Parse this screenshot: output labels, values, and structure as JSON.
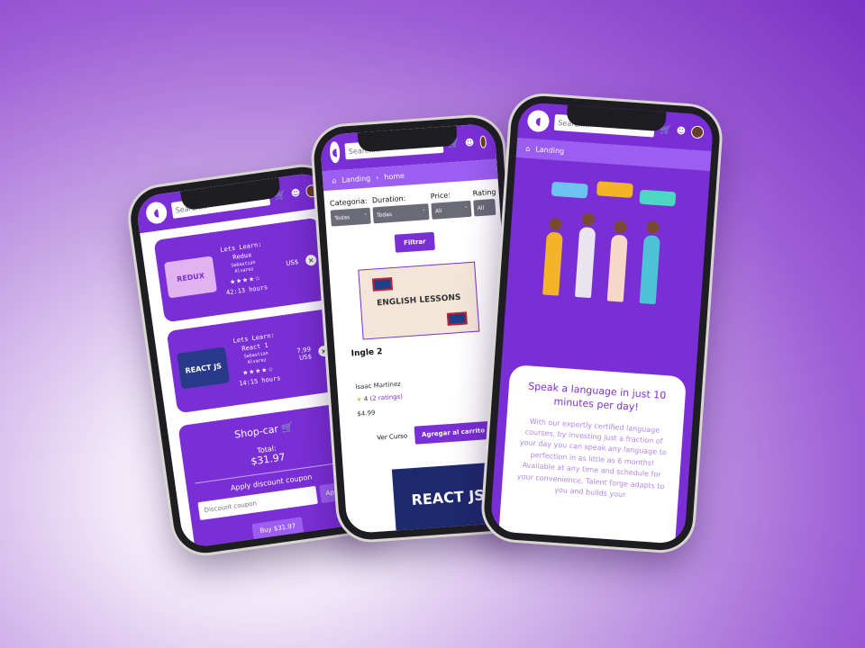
{
  "common": {
    "search_placeholder": "Search...",
    "logo_glyph": "◖",
    "cart_icon": "cart-icon",
    "user_icon": "user-icon"
  },
  "phone1": {
    "courses": [
      {
        "title": "Lets Learn:",
        "subtitle": "Redux",
        "author": "Sebastian Alvarez",
        "hours": "42:13 hours",
        "price_top": "",
        "price_bottom": "US$",
        "thumb": "REDUX",
        "stars": "★★★★☆"
      },
      {
        "title": "Lets Learn:",
        "subtitle": "React 1",
        "author": "Sebastian Alvarez",
        "hours": "14:15 hours",
        "price_top": "7,99",
        "price_bottom": "US$",
        "thumb": "REACT JS",
        "stars": "★★★★☆"
      }
    ],
    "shop": {
      "title": "Shop-car",
      "total_label": "Total:",
      "total": "$31.97",
      "coupon_label": "Apply discount coupon",
      "coupon_placeholder": "Discount coupon",
      "apply": "Apply",
      "buy": "Buy $31.97"
    }
  },
  "phone2": {
    "breadcrumb": [
      "Landing",
      "home"
    ],
    "filters": [
      {
        "label": "Categoria:",
        "value": "Todas"
      },
      {
        "label": "Duration:",
        "value": "Todas"
      },
      {
        "label": "Price:",
        "value": "All"
      },
      {
        "label": "Rating",
        "value": "All"
      }
    ],
    "filter_button": "Filtrar",
    "course": {
      "image_text": "ENGLISH LESSONS",
      "title": "Ingle 2",
      "author": "Isaac Martinez",
      "rating": "4",
      "ratings_count": "(2 ratings)",
      "price": "$4.99",
      "view": "Ver Curso",
      "add": "Agregar al carrito"
    },
    "next_image_text": "REACT JS"
  },
  "phone3": {
    "breadcrumb": "Landing",
    "headline": "Speak a language in just 10 minutes per day!",
    "body": "With our expertly certified language courses, by investing just a fraction of your day you can speak any language to perfection in as little as 6 months! Available at any time and schedule for your convenience. Talent forge adapts to you and builds your"
  },
  "colors": {
    "brand": "#7a2fd6",
    "brand_light": "#9b5ef0",
    "star": "#f3b42a"
  }
}
